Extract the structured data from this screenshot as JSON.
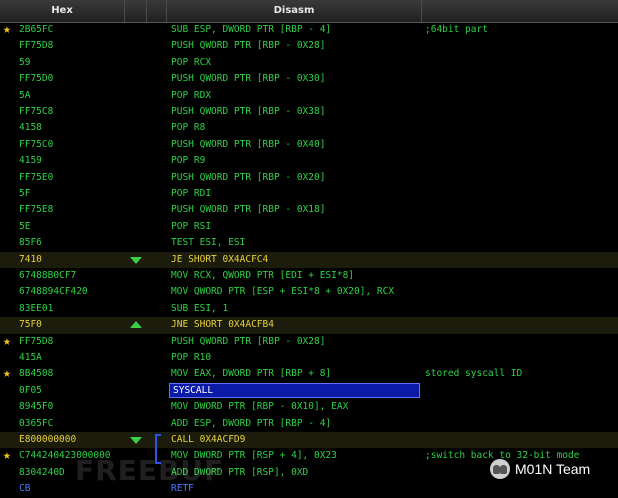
{
  "header": {
    "hex_label": "Hex",
    "disasm_label": "Disasm"
  },
  "rows": [
    {
      "hex": "2B65FC",
      "asm": "SUB ESP, DWORD PTR [RBP - 4]",
      "comment": ";64bit part",
      "star": true
    },
    {
      "hex": "FF75D8",
      "asm": "PUSH QWORD PTR [RBP - 0X28]"
    },
    {
      "hex": "59",
      "asm": "POP RCX"
    },
    {
      "hex": "FF75D0",
      "asm": "PUSH QWORD PTR [RBP - 0X30]"
    },
    {
      "hex": "5A",
      "asm": "POP RDX"
    },
    {
      "hex": "FF75C8",
      "asm": "PUSH QWORD PTR [RBP - 0X38]"
    },
    {
      "hex": "4158",
      "asm": "POP R8"
    },
    {
      "hex": "FF75C0",
      "asm": "PUSH QWORD PTR [RBP - 0X40]"
    },
    {
      "hex": "4159",
      "asm": "POP R9"
    },
    {
      "hex": "FF75E0",
      "asm": "PUSH QWORD PTR [RBP - 0X20]"
    },
    {
      "hex": "5F",
      "asm": "POP RDI"
    },
    {
      "hex": "FF75E8",
      "asm": "PUSH QWORD PTR [RBP - 0X18]"
    },
    {
      "hex": "5E",
      "asm": "POP RSI"
    },
    {
      "hex": "85F6",
      "asm": "TEST ESI, ESI"
    },
    {
      "hex": "7410",
      "asm": "JE SHORT 0X4ACFC4",
      "highlight": true,
      "arrow": "down"
    },
    {
      "hex": "67488B0CF7",
      "asm": "MOV RCX, QWORD PTR [EDI + ESI*8]"
    },
    {
      "hex": "6748894CF420",
      "asm": "MOV QWORD PTR [ESP + ESI*8 + 0X20], RCX"
    },
    {
      "hex": "83EE01",
      "asm": "SUB ESI, 1"
    },
    {
      "hex": "75F0",
      "asm": "JNE SHORT 0X4ACFB4",
      "highlight": true,
      "arrow": "up"
    },
    {
      "hex": "FF75D8",
      "asm": "PUSH QWORD PTR [RBP - 0X28]",
      "star": true
    },
    {
      "hex": "415A",
      "asm": "POP R10"
    },
    {
      "hex": "8B4508",
      "asm": "MOV EAX, DWORD PTR [RBP + 8]",
      "comment": "stored syscall ID",
      "star": true
    },
    {
      "hex": "0F05",
      "asm": "SYSCALL",
      "selected": true
    },
    {
      "hex": "8945F0",
      "asm": "MOV DWORD PTR [RBP - 0X10], EAX"
    },
    {
      "hex": "0365FC",
      "asm": "ADD ESP, DWORD PTR [RBP - 4]"
    },
    {
      "hex": "E800000000",
      "asm": "CALL 0X4ACFD9",
      "highlight": true,
      "arrow": "down"
    },
    {
      "hex": "C744240423000000",
      "asm": "MOV DWORD PTR [RSP + 4], 0X23",
      "comment": ";switch back to 32-bit mode",
      "star": true
    },
    {
      "hex": "8304240D",
      "asm": "ADD DWORD PTR [RSP], 0XD"
    },
    {
      "hex": "CB",
      "asm": "RETF",
      "hex_color": "#4a7bff",
      "asm_color": "#4a7bff"
    }
  ],
  "watermark": "FREEBUF",
  "brand": {
    "text": "M01N Team"
  }
}
